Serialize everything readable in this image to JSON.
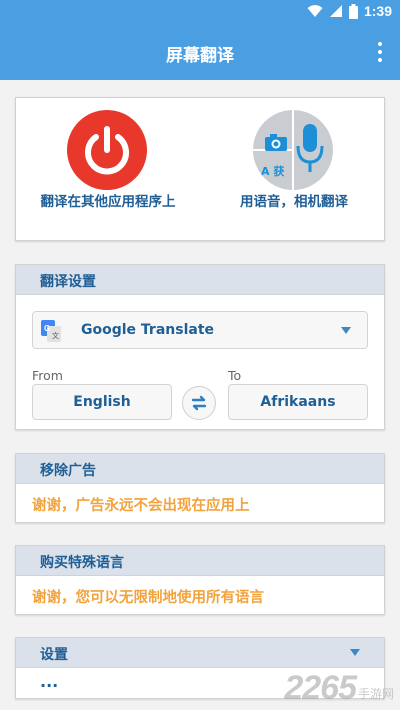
{
  "status_bar": {
    "time": "1:39"
  },
  "app_bar": {
    "title": "屏幕翻译"
  },
  "launch": {
    "translate_apps_label": "翻译在其他应用程序上",
    "voice_camera_label": "用语音，相机翻译",
    "camera_letters": "A 获"
  },
  "settings_card": {
    "header": "翻译设置",
    "engine": "Google Translate",
    "from_label": "From",
    "from_value": "English",
    "to_label": "To",
    "to_value": "Afrikaans"
  },
  "remove_ads": {
    "header": "移除广告",
    "message": "谢谢，广告永远不会出现在应用上"
  },
  "special_languages": {
    "header": "购买特殊语言",
    "message": "谢谢，您可以无限制地使用所有语言"
  },
  "settings": {
    "header": "设置",
    "more": "..."
  },
  "watermark": {
    "number": "2265",
    "site": "手游网"
  },
  "colors": {
    "primary": "#4a9fe3",
    "power_red": "#e8372b",
    "accent_orange": "#f2a33c",
    "text_blue": "#1f5f96"
  }
}
